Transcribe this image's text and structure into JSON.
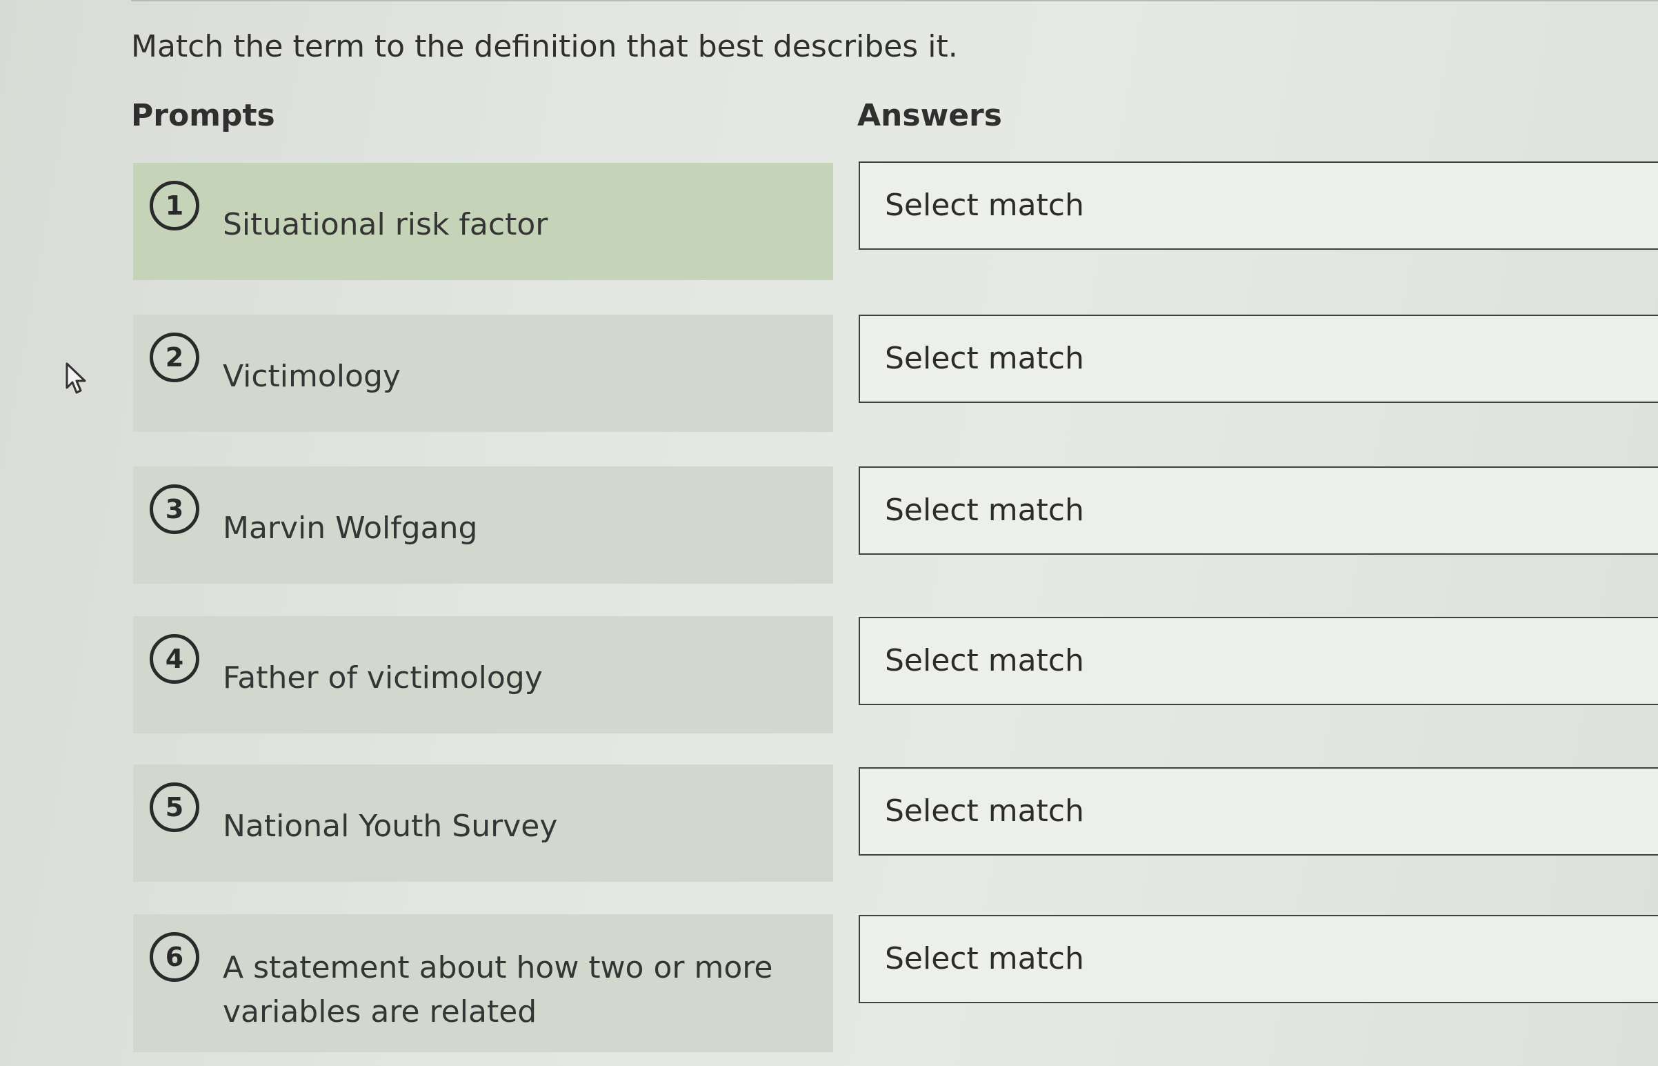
{
  "instructions": "Match the term to the definition that best describes it.",
  "prompts_header": "Prompts",
  "answers_header": "Answers",
  "prompts": [
    {
      "number": "1",
      "label": "Situational risk factor"
    },
    {
      "number": "2",
      "label": "Victimology"
    },
    {
      "number": "3",
      "label": "Marvin Wolfgang"
    },
    {
      "number": "4",
      "label": "Father of victimology"
    },
    {
      "number": "5",
      "label": "National Youth Survey"
    },
    {
      "number": "6",
      "label": "A statement about how two or more variables are related"
    }
  ],
  "answers": [
    {
      "value": "Select match"
    },
    {
      "value": "Select match"
    },
    {
      "value": "Select match"
    },
    {
      "value": "Select match"
    },
    {
      "value": "Select match"
    },
    {
      "value": "Select match"
    }
  ],
  "cursor_icon": "arrow-cursor-icon",
  "colors": {
    "highlight_prompt": "#c5d4b8",
    "prompt_background": "#d3d8cf",
    "answer_border": "#3f3f3f"
  }
}
